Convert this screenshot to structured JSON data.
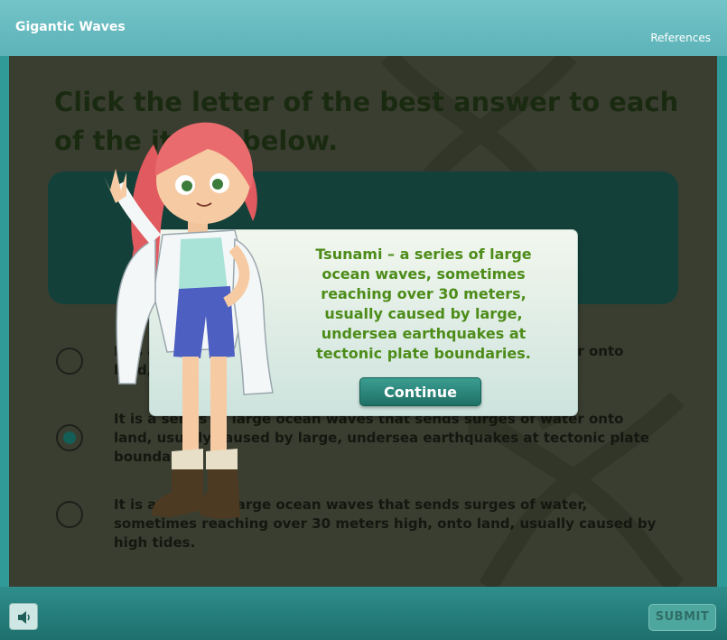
{
  "header": {
    "title": "Gigantic Waves",
    "references_label": "References"
  },
  "question": {
    "text": "Click the letter of the best answer to each of the items below."
  },
  "options": [
    {
      "text": "It is a series of large ocean waves that sends surges of water onto land, usually caused by large earthquakes.",
      "selected": false
    },
    {
      "text": "It is a series of large ocean waves that sends surges of water onto land, usually caused by large, undersea earthquakes at tectonic plate boundaries.",
      "selected": true
    },
    {
      "text": "It is a series of large ocean waves that sends surges of water, sometimes reaching over 30 meters high, onto land, usually caused by high tides.",
      "selected": false
    }
  ],
  "modal": {
    "text": "Tsunami – a series of large ocean waves, sometimes reaching over 30 meters, usually caused by large, undersea earthquakes at tectonic plate boundaries.",
    "continue_label": "Continue"
  },
  "footer": {
    "submit_label": "SUBMIT",
    "audio_icon": "speaker-icon"
  },
  "colors": {
    "accent": "#2f9a98",
    "modal_text": "#4d8c19",
    "button": "#1f7065"
  }
}
